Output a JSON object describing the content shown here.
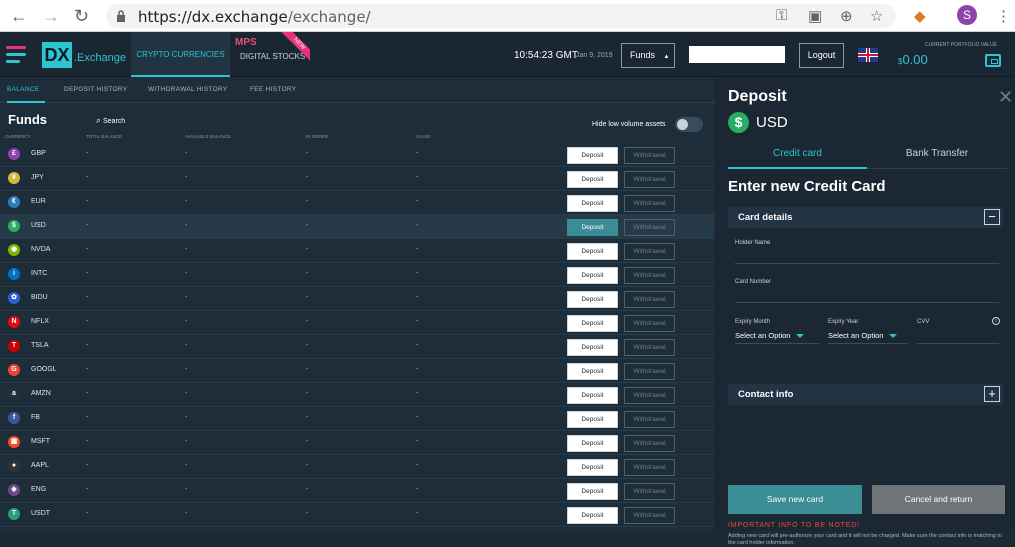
{
  "browser": {
    "url_host": "https://dx.exchange",
    "url_path": "/exchange/",
    "profile_initial": "S"
  },
  "header": {
    "logo_mark": "DX",
    "logo_text": ".Exchange",
    "tab_crypto": "CRYPTO CURRENCIES",
    "tab_stocks_brand": "MPS",
    "tab_stocks": "DIGITAL STOCKS",
    "new_badge": "NEW",
    "time": "10:54:23 GMT",
    "date": "Jan 9, 2019",
    "funds_dropdown": "Funds",
    "logout": "Logout",
    "portfolio_label": "CURRENT PORTFOLIO VALUE",
    "portfolio_currency": "$",
    "portfolio_value": "0.00",
    "colors": {
      "accent": "#2ec4d1",
      "brand_pink": "#e7317b"
    }
  },
  "subtabs": [
    "BALANCE",
    "DEPOSIT HISTORY",
    "WITHDRAWAL HISTORY",
    "FEE HISTORY"
  ],
  "funds": {
    "title": "Funds",
    "search": "Search",
    "hide_low": "Hide low volume assets",
    "columns": [
      "CURRENCY",
      "TOTAL BALANCE",
      "AVAILABLE BALANCE",
      "IN ORDER",
      "VALUE"
    ],
    "deposit_label": "Deposit",
    "withdrawal_label": "Withdrawal",
    "rows": [
      {
        "code": "GBP",
        "glyph": "£",
        "color": "#8e44ad",
        "total": "-",
        "available": "-",
        "in_order": "-",
        "value": "-"
      },
      {
        "code": "JPY",
        "glyph": "¥",
        "color": "#d4b83a",
        "total": "-",
        "available": "-",
        "in_order": "-",
        "value": "-"
      },
      {
        "code": "EUR",
        "glyph": "€",
        "color": "#2980b9",
        "total": "-",
        "available": "-",
        "in_order": "-",
        "value": "-"
      },
      {
        "code": "USD",
        "glyph": "$",
        "color": "#27ae60",
        "total": "-",
        "available": "-",
        "in_order": "-",
        "value": "-"
      },
      {
        "code": "NVDA",
        "glyph": "◉",
        "color": "#76b900",
        "total": "-",
        "available": "-",
        "in_order": "-",
        "value": "-"
      },
      {
        "code": "INTC",
        "glyph": "i",
        "color": "#0071c5",
        "total": "-",
        "available": "-",
        "in_order": "-",
        "value": "-"
      },
      {
        "code": "BIDU",
        "glyph": "✿",
        "color": "#2f5fd6",
        "total": "-",
        "available": "-",
        "in_order": "-",
        "value": "-"
      },
      {
        "code": "NFLX",
        "glyph": "N",
        "color": "#e50914",
        "total": "-",
        "available": "-",
        "in_order": "-",
        "value": "-"
      },
      {
        "code": "TSLA",
        "glyph": "T",
        "color": "#cc0000",
        "total": "-",
        "available": "-",
        "in_order": "-",
        "value": "-"
      },
      {
        "code": "GOOGL",
        "glyph": "G",
        "color": "#ea4335",
        "total": "-",
        "available": "-",
        "in_order": "-",
        "value": "-"
      },
      {
        "code": "AMZN",
        "glyph": "a",
        "color": "#232f3e",
        "total": "-",
        "available": "-",
        "in_order": "-",
        "value": "-"
      },
      {
        "code": "FB",
        "glyph": "f",
        "color": "#3b5998",
        "total": "-",
        "available": "-",
        "in_order": "-",
        "value": "-"
      },
      {
        "code": "MSFT",
        "glyph": "▦",
        "color": "#f25022",
        "total": "-",
        "available": "-",
        "in_order": "-",
        "value": "-"
      },
      {
        "code": "AAPL",
        "glyph": "●",
        "color": "#333333",
        "total": "-",
        "available": "-",
        "in_order": "-",
        "value": "-"
      },
      {
        "code": "ENG",
        "glyph": "◈",
        "color": "#6c4a8a",
        "total": "-",
        "available": "-",
        "in_order": "-",
        "value": "-"
      },
      {
        "code": "USDT",
        "glyph": "T",
        "color": "#26a17b",
        "total": "-",
        "available": "-",
        "in_order": "-",
        "value": "-"
      }
    ],
    "highlighted": "USD"
  },
  "deposit": {
    "title": "Deposit",
    "currency_glyph": "$",
    "currency": "USD",
    "tab_card": "Credit card",
    "tab_bank": "Bank Transfer",
    "heading": "Enter new Credit Card",
    "card_details": "Card details",
    "holder_name": "Holder Name",
    "card_number": "Card Number",
    "expiry_month": "Expiry Month",
    "expiry_year": "Expiry Year",
    "cvv": "CVV",
    "select_option": "Select an Option",
    "contact_info": "Contact info",
    "save_button": "Save new card",
    "cancel_button": "Cancel and return",
    "important": "IMPORTANT INFO TO BE NOTED!",
    "note": "Adding new card will pre-authorize your card and it will not be charged. Make sure the contact info is matching to the card holder information."
  }
}
